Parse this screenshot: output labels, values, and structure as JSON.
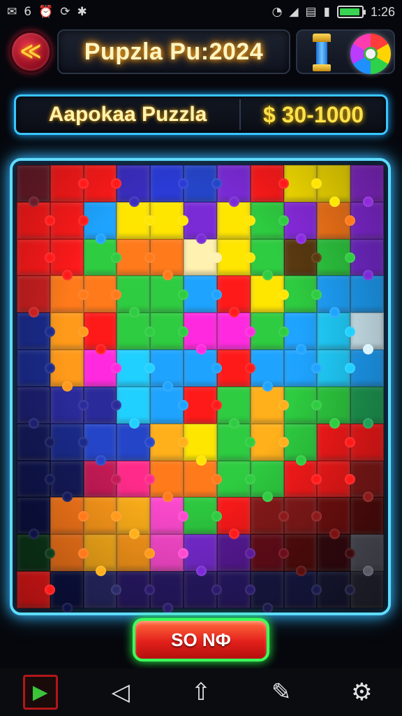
{
  "status_bar": {
    "left_icons": [
      "mail-icon",
      "signal-number",
      "alarm-icon",
      "sync-icon",
      "puzzle-icon"
    ],
    "left_texts": [
      "✉",
      "6",
      "⏰",
      "⟳",
      "✱"
    ],
    "right_icons": [
      "wifi-icon",
      "cell-signal-icon",
      "sim-icon",
      "cell-bars-icon"
    ],
    "right_texts": [
      "◔",
      "◢",
      "▤",
      "▮"
    ],
    "battery_level": 0.95,
    "time": "1:26"
  },
  "header": {
    "back_icon": "back-arrow-icon",
    "back_glyph": "≪",
    "title": "Pupzla Pu:2024",
    "tower_icon": "trophy-tower-icon",
    "wheel_icon": "prize-wheel-icon"
  },
  "info": {
    "puzzle_name": "Aapokaa Puzzla",
    "prize": "$ 30-1000"
  },
  "colors": {
    "accent_neon": "#5fdcff",
    "button_green_glow": "#3bff5a",
    "button_red": "#e3201b",
    "title_gold": "#ffe14a"
  },
  "board": {
    "columns": 11,
    "rows": 12,
    "tiles": [
      "#6a1c2a",
      "#ff1a1a",
      "#ff1a1a",
      "#3a2dbf",
      "#2a3bd6",
      "#2545c8",
      "#7a2bd6",
      "#ff1a1a",
      "#ffe600",
      "#ffe600",
      "#8f2bd9",
      "#ff1a1a",
      "#ff1a1a",
      "#1ea4ff",
      "#ffe600",
      "#ffe600",
      "#7a2bd6",
      "#ffe600",
      "#2ecc40",
      "#8a2be2",
      "#ff7a1a",
      "#8a2be2",
      "#ff1a1a",
      "#ff1a1a",
      "#2ecc40",
      "#ff7a1a",
      "#ff7a1a",
      "#fff1b0",
      "#ffe600",
      "#2ecc40",
      "#5a3a10",
      "#2ecc40",
      "#7a2bd6",
      "#c91f1f",
      "#ff7a1a",
      "#ff7a1a",
      "#2ecc40",
      "#2ecc40",
      "#1ea4ff",
      "#ff1a1a",
      "#ffe600",
      "#2ecc40",
      "#1ea4ff",
      "#1ea4ff",
      "#1a2a8a",
      "#ff9a1a",
      "#ff1a1a",
      "#2ecc40",
      "#2ecc40",
      "#ff2adf",
      "#ff2adf",
      "#2ecc40",
      "#1ea4ff",
      "#20d0ff",
      "#d9f4ff",
      "#1a2a8a",
      "#ff9a1a",
      "#ff2adf",
      "#20d0ff",
      "#1ea4ff",
      "#1ea4ff",
      "#ff1a1a",
      "#1ea4ff",
      "#1ea4ff",
      "#20d0ff",
      "#1ea4ff",
      "#1c1f6e",
      "#2a2a9a",
      "#2a2a9a",
      "#20d0ff",
      "#1ea4ff",
      "#ff1a1a",
      "#2ecc40",
      "#ffb01a",
      "#2ecc40",
      "#2ecc40",
      "#1ea055",
      "#141a5a",
      "#1a2a8a",
      "#2545c8",
      "#2545c8",
      "#ffb01a",
      "#ffe600",
      "#2ecc40",
      "#ffb01a",
      "#2ecc40",
      "#ff1a1a",
      "#ff1a1a",
      "#101650",
      "#141a5a",
      "#c41a55",
      "#ff2a8a",
      "#ff7a1a",
      "#ff7a1a",
      "#2ecc40",
      "#2ecc40",
      "#ff1a1a",
      "#ff1a1a",
      "#8a1a1a",
      "#0d1244",
      "#ff7a1a",
      "#ff9a1a",
      "#ffb01a",
      "#ff4ad0",
      "#2ecc40",
      "#ff1a1a",
      "#8a1a1a",
      "#8a1a1a",
      "#7a1010",
      "#5a0d0d",
      "#0d3a1a",
      "#ff7a1a",
      "#ffb01a",
      "#ff9a1a",
      "#ff4ad0",
      "#7a2bd6",
      "#5a1a9a",
      "#6a0d1a",
      "#5a0d0d",
      "#3a0a10",
      "#5a5a66",
      "#ff1a1a",
      "#0d1244",
      "#2a2a6a",
      "#2a1a6a",
      "#2a1a6a",
      "#2a1a6a",
      "#2a1a6a",
      "#1a1a4a",
      "#1a1a4a",
      "#1a1a3a",
      "#2a2a3a"
    ]
  },
  "action_button": {
    "label": "SO NФ"
  },
  "nav_bar": {
    "items": [
      {
        "name": "play-icon",
        "glyph": "▶"
      },
      {
        "name": "back-nav-icon",
        "glyph": "◁"
      },
      {
        "name": "share-icon",
        "glyph": "⇧"
      },
      {
        "name": "edit-icon",
        "glyph": "✎"
      },
      {
        "name": "gear-icon",
        "glyph": "⚙"
      }
    ]
  }
}
